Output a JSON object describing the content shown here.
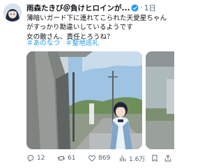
{
  "post": {
    "author_name": "雨森たきび＠負けヒロインが...",
    "separator": "·",
    "time": "1日",
    "text_lines": [
      "薄暗いガード下に連れてこられた天愛星ちゃん",
      "がすっかり勘違いしているようです",
      "女の敵さん、責任とろうね？"
    ],
    "hashtags": [
      "＃あのなつ",
      "＃聖地巡礼"
    ]
  },
  "actions": {
    "replies": "12",
    "reposts": "61",
    "likes": "869",
    "views": "1.6万"
  },
  "colors": {
    "link": "#1d9bf0",
    "verified": "#1d9bf0",
    "muted": "#536471"
  }
}
